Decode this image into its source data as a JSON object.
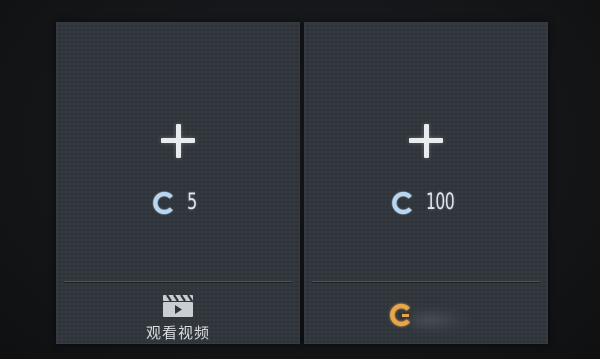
{
  "slots": [
    {
      "action_icon": "plus-icon",
      "cost_icon": "coin-icon",
      "cost": "5",
      "footer": {
        "icon": "video-clapper-icon",
        "label": "观看视频"
      }
    },
    {
      "action_icon": "plus-icon",
      "cost_icon": "coin-icon",
      "cost": "100",
      "footer": {
        "icon": "gold-coin-icon"
      }
    }
  ],
  "colors": {
    "panel": "#2f353b",
    "background": "#14171a",
    "text": "#e2e6ea",
    "coin_blue": "#b8d6f0",
    "coin_gold": "#e8a54a"
  }
}
